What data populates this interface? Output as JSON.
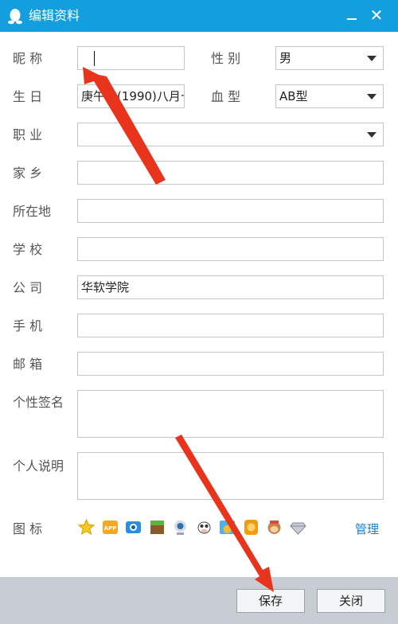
{
  "window": {
    "title": "编辑资料",
    "close_label": "✕"
  },
  "form": {
    "nickname": {
      "label": "昵 称",
      "value": ""
    },
    "gender": {
      "label": "性 别",
      "value": "男"
    },
    "birthday": {
      "label": "生 日",
      "value": "庚午年(1990)八月十"
    },
    "blood_type": {
      "label": "血 型",
      "value": "AB型"
    },
    "occupation": {
      "label": "职 业",
      "value": ""
    },
    "hometown": {
      "label": "家 乡",
      "value": ""
    },
    "location": {
      "label": "所在地",
      "value": ""
    },
    "school": {
      "label": "学 校",
      "value": ""
    },
    "company": {
      "label": "公 司",
      "value": "华软学院"
    },
    "phone": {
      "label": "手 机",
      "value": ""
    },
    "email": {
      "label": "邮 箱",
      "value": ""
    },
    "signature": {
      "label": "个性签名",
      "value": ""
    },
    "description": {
      "label": "个人说明",
      "value": ""
    },
    "icons": {
      "label": "图 标",
      "manage_label": "管理",
      "items": [
        "star-icon",
        "app-icon",
        "camera-icon",
        "block-icon",
        "webcam-icon",
        "cow-icon",
        "penguin-icon",
        "badge-icon",
        "monkey-icon",
        "diamond-icon"
      ]
    }
  },
  "footer": {
    "save_label": "保存",
    "close_label": "关闭"
  },
  "colors": {
    "titlebar": "#139fde",
    "footer": "#c7cdd2",
    "arrow": "#e8341c",
    "link": "#1a7fc4"
  }
}
